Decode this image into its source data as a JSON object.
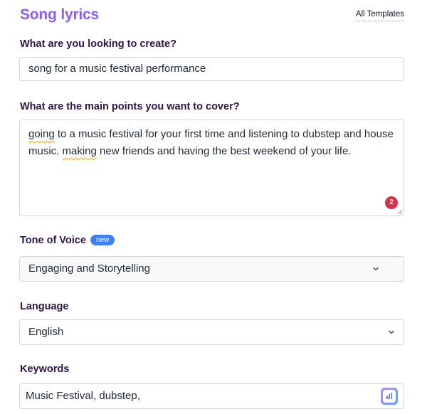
{
  "header": {
    "title": "Song lyrics",
    "all_templates_label": "All Templates"
  },
  "create": {
    "label": "What are you looking to create?",
    "value": "song for a music festival performance"
  },
  "main_points": {
    "label": "What are the main points you want to cover?",
    "segments": {
      "s1": "going",
      "s2": " to a music festival for your first time and listening to dubstep and house music. ",
      "s3": "making",
      "s4": " new friends and having the best weekend of your life."
    },
    "error_count": "2"
  },
  "tone": {
    "label": "Tone of Voice",
    "badge": "new",
    "selected": "Engaging and Storytelling"
  },
  "language": {
    "label": "Language",
    "selected": "English"
  },
  "keywords": {
    "label": "Keywords",
    "value": "Music Festival, dubstep,"
  },
  "colors": {
    "title": "#8b5cf6",
    "label": "#2e1548",
    "badge_new": "#3b82f6",
    "error_badge": "#dc2f45",
    "squiggle": "#e0a21a"
  }
}
